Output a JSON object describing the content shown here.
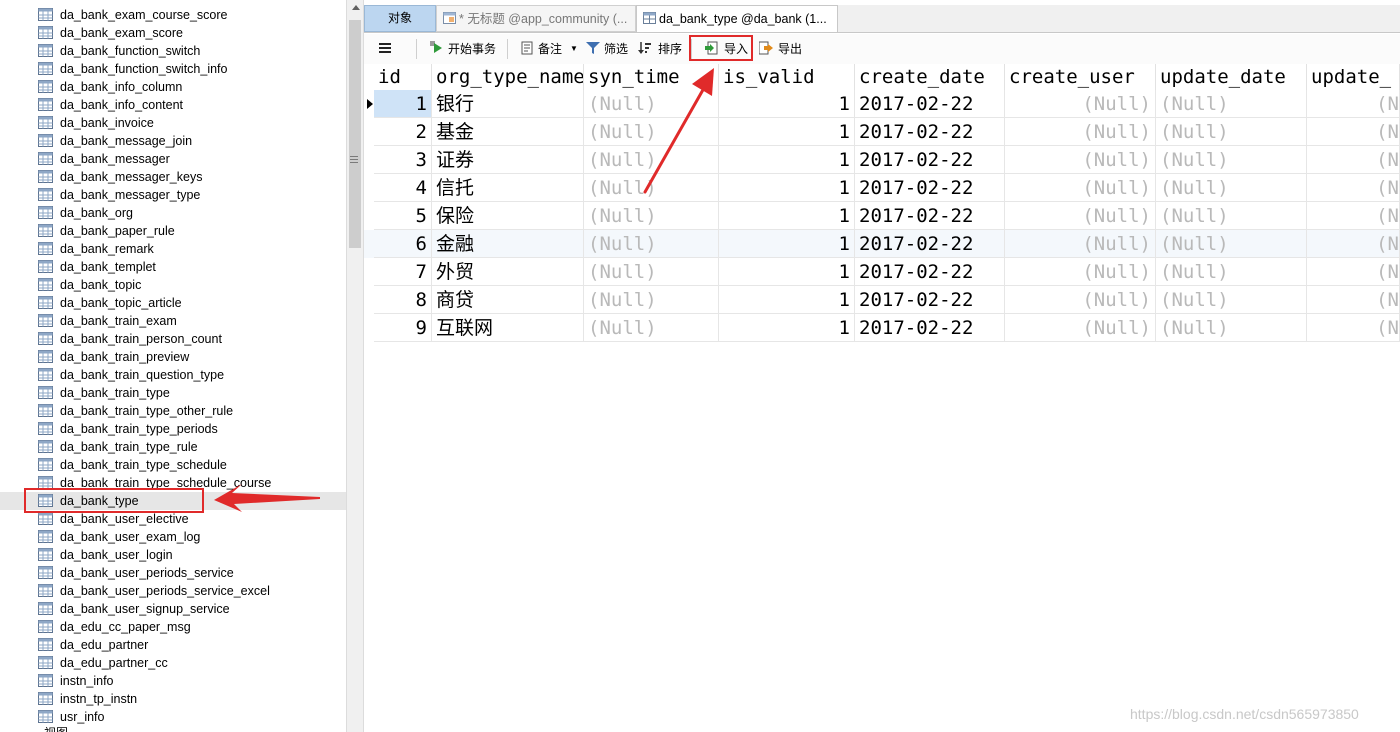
{
  "tree": {
    "items": [
      "da_bank_exam_course_score",
      "da_bank_exam_score",
      "da_bank_function_switch",
      "da_bank_function_switch_info",
      "da_bank_info_column",
      "da_bank_info_content",
      "da_bank_invoice",
      "da_bank_message_join",
      "da_bank_messager",
      "da_bank_messager_keys",
      "da_bank_messager_type",
      "da_bank_org",
      "da_bank_paper_rule",
      "da_bank_remark",
      "da_bank_templet",
      "da_bank_topic",
      "da_bank_topic_article",
      "da_bank_train_exam",
      "da_bank_train_person_count",
      "da_bank_train_preview",
      "da_bank_train_question_type",
      "da_bank_train_type",
      "da_bank_train_type_other_rule",
      "da_bank_train_type_periods",
      "da_bank_train_type_rule",
      "da_bank_train_type_schedule",
      "da_bank_train_type_schedule_course",
      "da_bank_type",
      "da_bank_user_elective",
      "da_bank_user_exam_log",
      "da_bank_user_login",
      "da_bank_user_periods_service",
      "da_bank_user_periods_service_excel",
      "da_bank_user_signup_service",
      "da_edu_cc_paper_msg",
      "da_edu_partner",
      "da_edu_partner_cc",
      "instn_info",
      "instn_tp_instn",
      "usr_info"
    ],
    "selected": "da_bank_type",
    "next_group_label": "视图"
  },
  "tabs": {
    "objects": "对象",
    "query": "* 无标题 @app_community (...",
    "table": "da_bank_type @da_bank (1..."
  },
  "toolbar": {
    "begin_transaction": "开始事务",
    "memo": "备注",
    "filter": "筛选",
    "sort": "排序",
    "import": "导入",
    "export": "导出"
  },
  "grid": {
    "columns": [
      "id",
      "org_type_name",
      "syn_time",
      "is_valid",
      "create_date",
      "create_user",
      "update_date",
      "update_"
    ],
    "rows": [
      {
        "id": "1",
        "org_type_name": "银行",
        "syn_time": "(Null)",
        "is_valid": "1",
        "create_date": "2017-02-22",
        "create_user": "(Null)",
        "update_date": "(Null)",
        "update_user": "(N"
      },
      {
        "id": "2",
        "org_type_name": "基金",
        "syn_time": "(Null)",
        "is_valid": "1",
        "create_date": "2017-02-22",
        "create_user": "(Null)",
        "update_date": "(Null)",
        "update_user": "(N"
      },
      {
        "id": "3",
        "org_type_name": "证券",
        "syn_time": "(Null)",
        "is_valid": "1",
        "create_date": "2017-02-22",
        "create_user": "(Null)",
        "update_date": "(Null)",
        "update_user": "(N"
      },
      {
        "id": "4",
        "org_type_name": "信托",
        "syn_time": "(Null)",
        "is_valid": "1",
        "create_date": "2017-02-22",
        "create_user": "(Null)",
        "update_date": "(Null)",
        "update_user": "(N"
      },
      {
        "id": "5",
        "org_type_name": "保险",
        "syn_time": "(Null)",
        "is_valid": "1",
        "create_date": "2017-02-22",
        "create_user": "(Null)",
        "update_date": "(Null)",
        "update_user": "(N"
      },
      {
        "id": "6",
        "org_type_name": "金融",
        "syn_time": "(Null)",
        "is_valid": "1",
        "create_date": "2017-02-22",
        "create_user": "(Null)",
        "update_date": "(Null)",
        "update_user": "(N"
      },
      {
        "id": "7",
        "org_type_name": "外贸",
        "syn_time": "(Null)",
        "is_valid": "1",
        "create_date": "2017-02-22",
        "create_user": "(Null)",
        "update_date": "(Null)",
        "update_user": "(N"
      },
      {
        "id": "8",
        "org_type_name": "商贷",
        "syn_time": "(Null)",
        "is_valid": "1",
        "create_date": "2017-02-22",
        "create_user": "(Null)",
        "update_date": "(Null)",
        "update_user": "(N"
      },
      {
        "id": "9",
        "org_type_name": "互联网",
        "syn_time": "(Null)",
        "is_valid": "1",
        "create_date": "2017-02-22",
        "create_user": "(Null)",
        "update_date": "(Null)",
        "update_user": "(N"
      }
    ]
  },
  "icons": {
    "table": "table-icon",
    "menu": "hamburger-menu-icon",
    "begin_transaction": "play-icon",
    "memo": "memo-icon",
    "filter": "funnel-icon",
    "sort": "sort-icon",
    "import": "import-icon",
    "export": "export-icon"
  },
  "colors": {
    "annotation": "#e02a2a",
    "selected_tab": "#bcd6f0",
    "null_text": "#b9b9b9"
  },
  "watermark": "https://blog.csdn.net/csdn565973850"
}
